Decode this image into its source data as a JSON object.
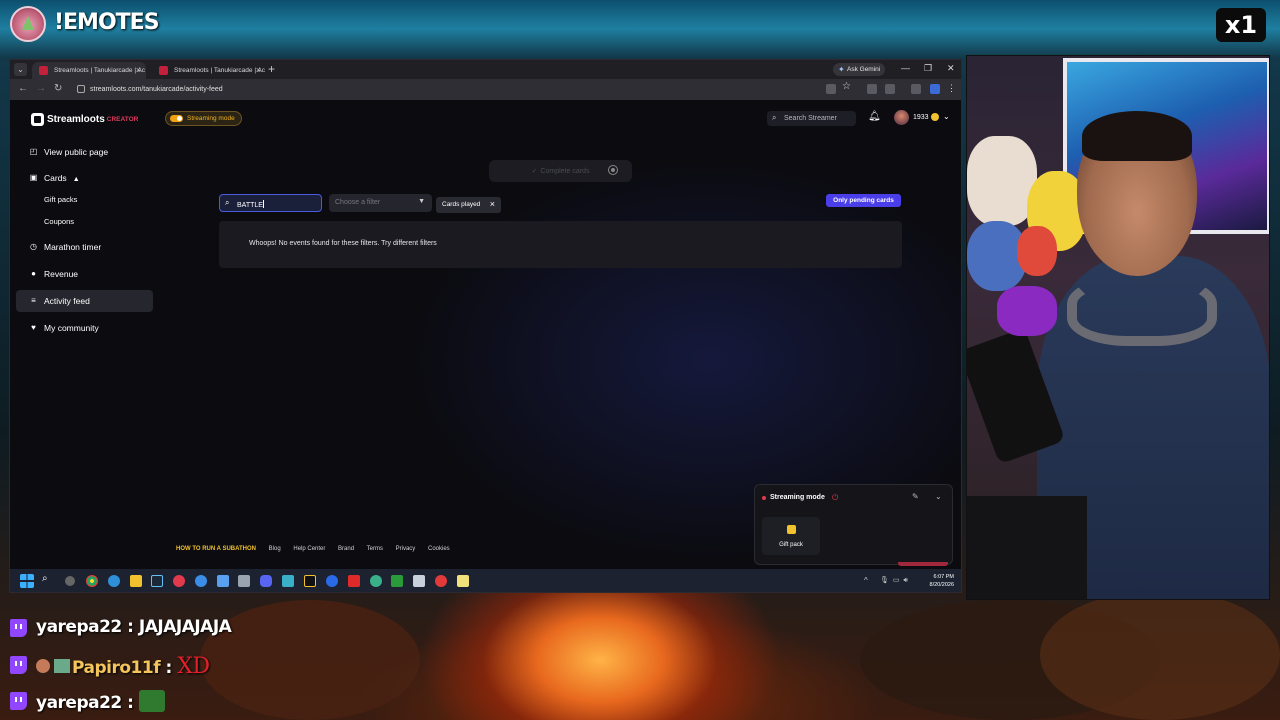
{
  "overlay": {
    "title": "!EMOTES",
    "multiplier": "x1"
  },
  "browser": {
    "tabs": [
      {
        "label": "Streamloots | Tanukiarcade | Ac"
      },
      {
        "label": "Streamloots | Tanukiarcade | Ac"
      }
    ],
    "new_tab": "+",
    "gemini_label": "Ask Gemini",
    "url": "streamloots.com/tanukiarcade/activity-feed"
  },
  "app": {
    "logo_name": "Streamloots",
    "logo_tag": "CREATOR",
    "streaming_mode_toggle": "Streaming mode",
    "search_placeholder": "Search Streamer",
    "coins": "1933"
  },
  "sidebar": {
    "items": [
      {
        "label": "View public page",
        "icon": "external-page-icon"
      },
      {
        "label": "Cards",
        "icon": "cards-icon",
        "expanded": true
      },
      {
        "label": "Gift packs"
      },
      {
        "label": "Coupons"
      },
      {
        "label": "Marathon timer",
        "icon": "timer-icon"
      },
      {
        "label": "Revenue",
        "icon": "revenue-icon"
      },
      {
        "label": "Activity feed",
        "icon": "activity-icon",
        "active": true
      },
      {
        "label": "My community",
        "icon": "community-icon"
      }
    ]
  },
  "main": {
    "complete_cards": "Complete cards",
    "search_value": "BATTLE",
    "filter_placeholder": "Choose a filter",
    "active_chip": "Cards played",
    "only_pending": "Only pending cards",
    "empty_message": "Whoops! No events found for these filters. Try different filters"
  },
  "footer": {
    "links": [
      "HOW TO RUN A SUBATHON",
      "Blog",
      "Help Center",
      "Brand",
      "Terms",
      "Privacy",
      "Cookies"
    ]
  },
  "streaming_popup": {
    "title": "Streaming mode",
    "gift_label": "Gift pack"
  },
  "taskbar": {
    "time": "6:07 PM",
    "date": "8/20/2026"
  },
  "chat": [
    {
      "user": "yarepa22",
      "message": "JAJAJAJAJA"
    },
    {
      "user": "Papiro11f",
      "message": "XD"
    },
    {
      "user": "yarepa22",
      "message": ""
    }
  ],
  "colors": {
    "accent": "#4a3ee8",
    "brand_red": "#e03a5c",
    "streaming_yellow": "#f2b320",
    "twitch": "#9146ff"
  }
}
